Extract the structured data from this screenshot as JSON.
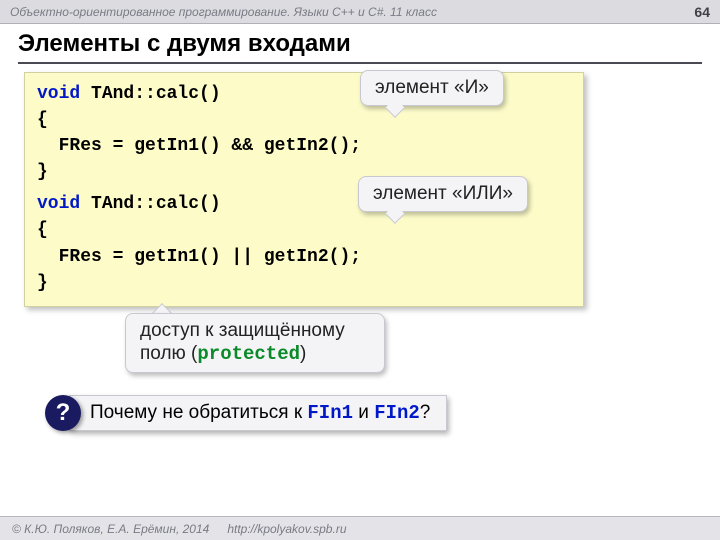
{
  "header": {
    "course": "Объектно-ориентированное программирование. Языки C++ и C#. 11 класс",
    "page": "64"
  },
  "title": "Элементы с двумя входами",
  "code": {
    "kw_void": "void",
    "block1": {
      "sig": " TAnd::calc()",
      "open": "{",
      "body": "  FRes = getIn1() && getIn2();",
      "close": "}"
    },
    "block2": {
      "sig": " TAnd::calc()",
      "open": "{",
      "body": "  FRes = getIn1() || getIn2();",
      "close": "}"
    }
  },
  "callouts": {
    "and": "элемент «И»",
    "or": "элемент «ИЛИ»",
    "prot_pre": "доступ к защищённому полю (",
    "prot_kw": "protected",
    "prot_post": ")"
  },
  "question": {
    "mark": "?",
    "pre": "Почему не обратиться к ",
    "f1": "FIn1",
    "mid": " и ",
    "f2": "FIn2",
    "post": "?"
  },
  "footer": {
    "copyright": "© К.Ю. Поляков, Е.А. Ерёмин, 2014",
    "url": "http://kpolyakov.spb.ru"
  }
}
